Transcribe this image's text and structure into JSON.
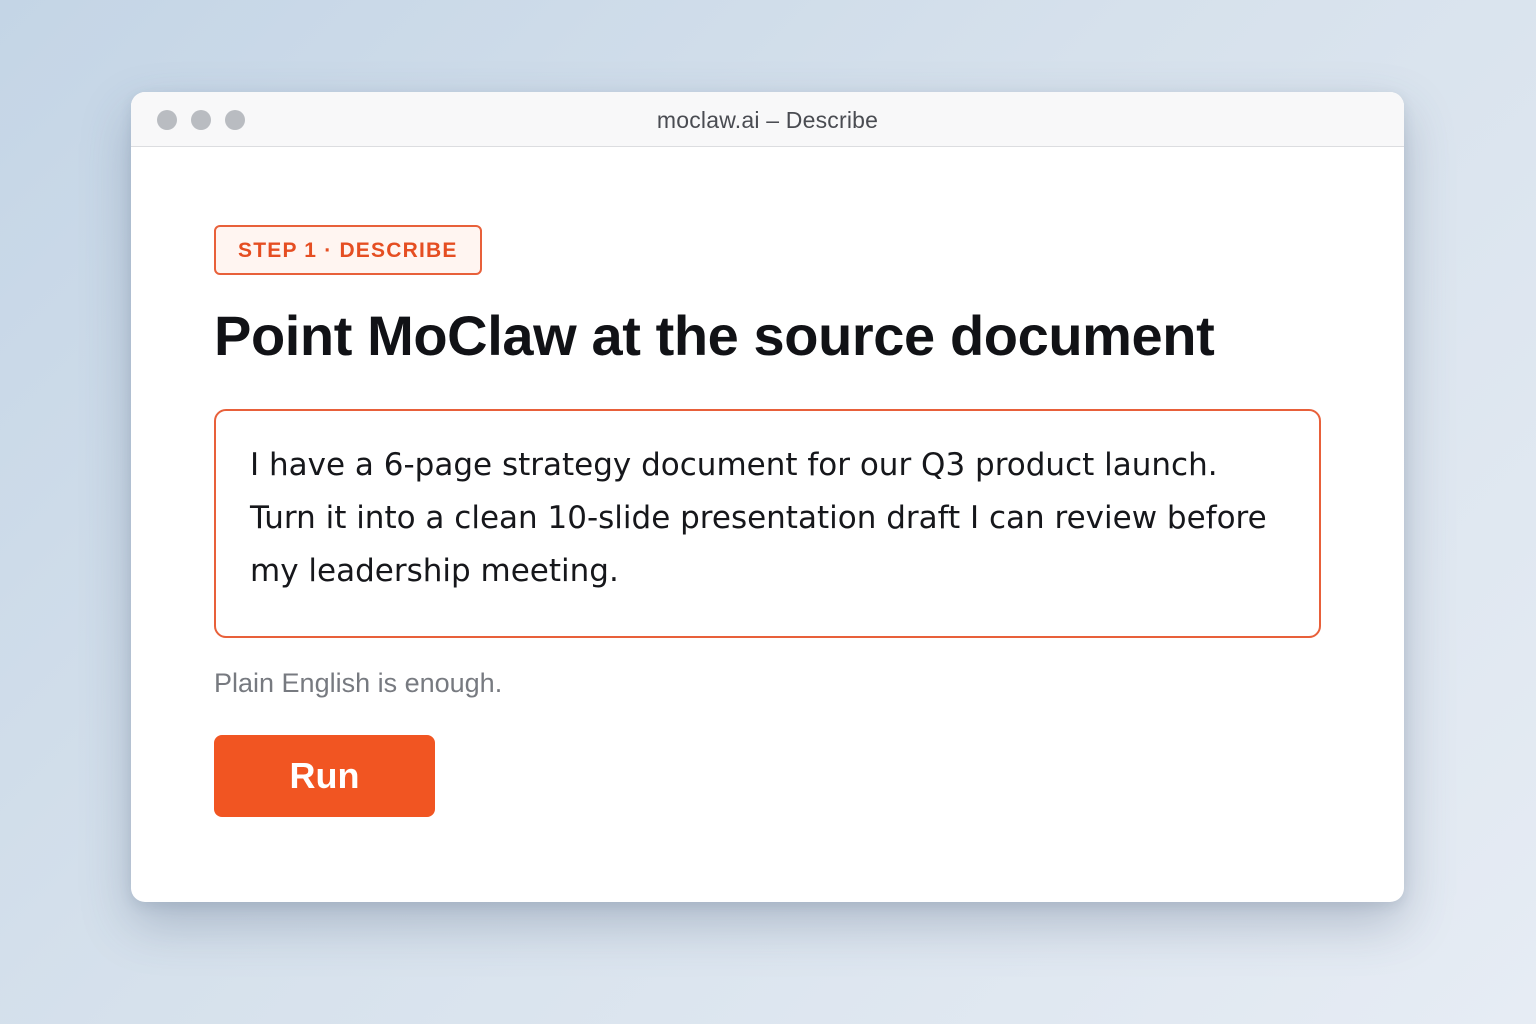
{
  "window": {
    "title": "moclaw.ai – Describe"
  },
  "step_badge": {
    "label": "STEP 1 · DESCRIBE"
  },
  "headline": "Point MoClaw at the source document",
  "prompt": {
    "value": "I have a 6-page strategy document for our Q3 product launch. Turn it into a clean 10-slide presentation draft I can review before my leadership meeting."
  },
  "hint": "Plain English is enough.",
  "run_button": {
    "label": "Run"
  },
  "colors": {
    "accent": "#f15522",
    "accent_border": "#e8603a",
    "background": "#d6e1ec"
  }
}
